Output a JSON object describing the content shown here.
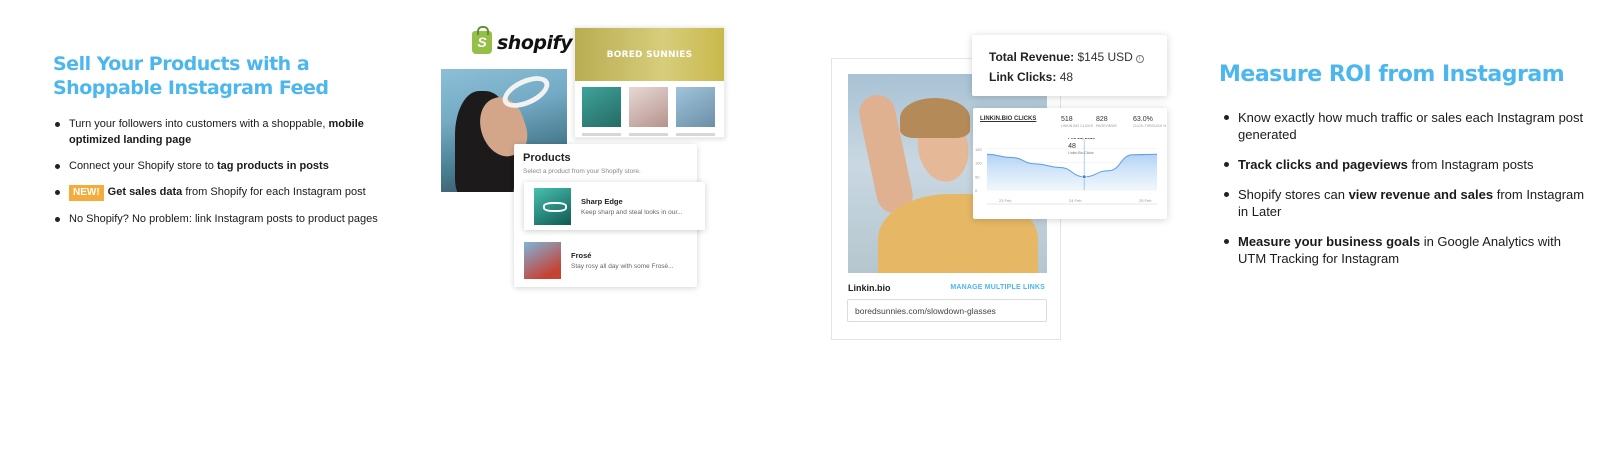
{
  "left": {
    "heading": "Sell Your Products with a Shoppable Instagram Feed",
    "bullets": [
      {
        "pre": "Turn your followers into customers with a shoppable, ",
        "bold": "mobile optimized landing page",
        "post": ""
      },
      {
        "pre": "Connect your Shopify store to ",
        "bold": "tag products in posts",
        "post": ""
      },
      {
        "badge": "NEW!",
        "bold": "Get sales data",
        "post": " from Shopify for each Instagram post"
      },
      {
        "pre": "No Shopify? No problem: link Instagram posts to product pages"
      }
    ]
  },
  "shopify_mockup": {
    "logo_text": "shopify",
    "logo_glyph": "S",
    "store_banner": "BORED SUNNIES",
    "products_title": "Products",
    "products_subtitle": "Select a product from your Shopify store.",
    "products": [
      {
        "name": "Sharp Edge",
        "desc": "Keep sharp and steal looks in our..."
      },
      {
        "name": "Frosé",
        "desc": "Stay rosy all day with some Frosé..."
      }
    ]
  },
  "linkin_mockup": {
    "revenue_label": "Total Revenue:",
    "revenue_value": "$145 USD",
    "clicks_label": "Link Clicks:",
    "clicks_value": "48",
    "link_label": "Linkin.bio",
    "manage_label": "MANAGE MULTIPLE LINKS",
    "url": "boredsunnies.com/slowdown-glasses",
    "chart_title": "LINKIN.BIO CLICKS",
    "stats": [
      {
        "value": "518",
        "label": "LINKIN.BIO CLICKS"
      },
      {
        "value": "828",
        "label": "PAGEVIEWS"
      },
      {
        "value": "63.0%",
        "label": "CLICK-THROUGH %"
      }
    ],
    "tooltip_date": "Feb 24, 2019",
    "tooltip_value": "48",
    "tooltip_label": "Linkin.Bio Clicks",
    "accent": "#4cb7ee",
    "badge_color": "#f3ad3c"
  },
  "chart_data": {
    "type": "area",
    "x": [
      "23 Feb",
      "24 Feb",
      "25 Feb"
    ],
    "y_ticks": [
      "150",
      "100",
      "50",
      "0"
    ],
    "values": [
      130,
      118,
      95,
      82,
      48,
      70,
      128,
      130
    ],
    "ylim": [
      0,
      160
    ],
    "highlight": {
      "x": "Feb 24, 2019",
      "value": 48
    }
  },
  "right": {
    "heading": "Measure ROI from Instagram",
    "bullets": [
      {
        "pre": "Know exactly how much traffic or sales each Instagram post generated"
      },
      {
        "bold": "Track clicks and pageviews",
        "post": " from Instagram posts"
      },
      {
        "pre": "Shopify stores can ",
        "bold": "view revenue and sales",
        "post": " from Instagram in Later"
      },
      {
        "bold": "Measure your business goals",
        "post": " in Google Analytics with UTM Tracking for Instagram"
      }
    ]
  }
}
